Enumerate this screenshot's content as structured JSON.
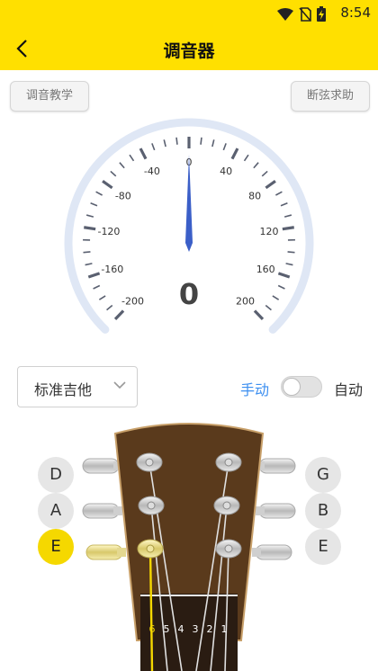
{
  "status_bar": {
    "time": "8:54"
  },
  "header": {
    "title": "调音器"
  },
  "buttons": {
    "tutorial": "调音教学",
    "broken_string_help": "断弦求助"
  },
  "gauge": {
    "cents_value": 0,
    "reading_label": "0",
    "scale_labels": [
      "-200",
      "-160",
      "-120",
      "-80",
      "-40",
      "0",
      "40",
      "80",
      "120",
      "160",
      "200"
    ]
  },
  "instrument": {
    "selected": "标准吉他"
  },
  "mode": {
    "manual_label": "手动",
    "auto_label": "自动",
    "auto_enabled": false
  },
  "strings": {
    "left": [
      {
        "note": "D",
        "active": false
      },
      {
        "note": "A",
        "active": false
      },
      {
        "note": "E",
        "active": true
      }
    ],
    "right": [
      {
        "note": "G",
        "active": false
      },
      {
        "note": "B",
        "active": false
      },
      {
        "note": "E",
        "active": false
      }
    ],
    "numbers": [
      "6",
      "5",
      "4",
      "3",
      "2",
      "1"
    ],
    "active_string": "6"
  },
  "colors": {
    "accent": "#FFE000",
    "active_note": "#F5D800",
    "needle": "#3b5fc8",
    "manual_label": "#3d8ff0",
    "headstock": "#5a3a1c"
  }
}
